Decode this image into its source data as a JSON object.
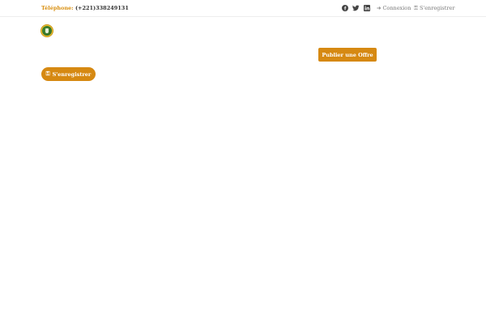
{
  "topbar": {
    "phone_label": "Téléphone:",
    "phone_number": "(+221)338249131",
    "social": {
      "facebook_icon": "facebook-icon",
      "twitter_icon": "twitter-icon",
      "linkedin_icon": "linkedin-icon"
    },
    "login_label": "Connexion",
    "login_icon": "sign-in-icon",
    "register_label": "S'enregistrer",
    "register_icon": "key-icon"
  },
  "header": {
    "logo_icon": "logo-emblem"
  },
  "main": {
    "publish_offer_label": "Publier une Offre",
    "register_button_label": "S'enregistrer",
    "register_button_icon": "key-icon"
  },
  "colors": {
    "accent": "#d68912",
    "phone_label": "#d99011",
    "muted_text": "#777777",
    "social_icons": "#444444"
  }
}
